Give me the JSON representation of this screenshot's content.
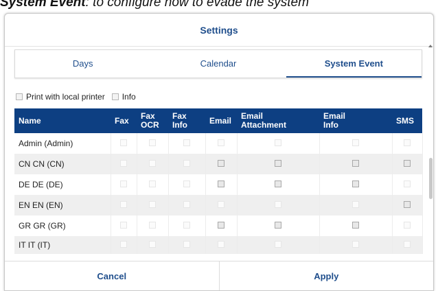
{
  "caption": {
    "bold": "System Event",
    "rest": ": to configure how to evade the system"
  },
  "dialog": {
    "title": "Settings"
  },
  "tabs": [
    "Days",
    "Calendar",
    "System Event"
  ],
  "active_tab": 2,
  "options": {
    "print_local": "Print with local printer",
    "info": "Info"
  },
  "columns": [
    "Name",
    "Fax",
    "Fax OCR",
    "Fax Info",
    "Email",
    "Email Attachment",
    "Email Info",
    "SMS"
  ],
  "rows": [
    {
      "name": "Admin (Admin)",
      "checks": [
        0,
        0,
        0,
        0,
        0,
        0,
        0
      ]
    },
    {
      "name": "CN CN (CN)",
      "checks": [
        0,
        0,
        0,
        1,
        1,
        1,
        1
      ]
    },
    {
      "name": "DE DE (DE)",
      "checks": [
        0,
        0,
        0,
        1,
        1,
        1,
        0
      ]
    },
    {
      "name": "EN EN (EN)",
      "checks": [
        0,
        0,
        0,
        0,
        0,
        0,
        1
      ]
    },
    {
      "name": "GR GR (GR)",
      "checks": [
        0,
        0,
        0,
        1,
        1,
        1,
        0
      ]
    },
    {
      "name": "IT IT (IT)",
      "checks": [
        0,
        0,
        0,
        0,
        0,
        0,
        0
      ]
    }
  ],
  "footer": {
    "cancel": "Cancel",
    "apply": "Apply"
  },
  "colors": {
    "accent": "#1f4e8c",
    "header_bg": "#0d3f82"
  }
}
